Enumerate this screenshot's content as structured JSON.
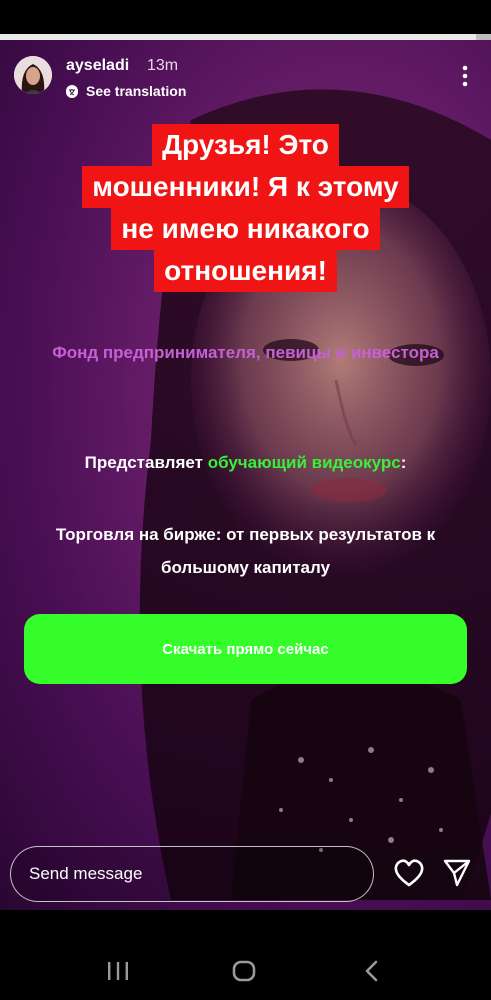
{
  "story": {
    "progress": 0.97,
    "username": "ayseladi",
    "time_ago": "13m",
    "see_translation": "See translation",
    "warning_lines": [
      "Друзья! Это",
      "мошенники! Я к этому",
      "не имею никакого",
      "отношения!"
    ],
    "fund_text": "Фонд предпринимателя, певицы и инвестора",
    "present_prefix": "Представляет ",
    "present_highlight": "обучающий видеокурс",
    "present_suffix": ":",
    "course_title": "Торговля на бирже: от первых результатов к большому капиталу",
    "cta_label": "Скачать прямо сейчас"
  },
  "reply": {
    "placeholder": "Send message"
  },
  "colors": {
    "warning_bg": "#f01414",
    "fund_text": "#c561d4",
    "highlight_green": "#39ef39",
    "cta_bg": "#35fd2a"
  },
  "icons": {
    "more": "more-vertical-icon",
    "translate": "translate-icon",
    "heart": "heart-icon",
    "send": "send-icon",
    "recents": "recents-icon",
    "home": "home-icon",
    "back": "back-icon"
  }
}
